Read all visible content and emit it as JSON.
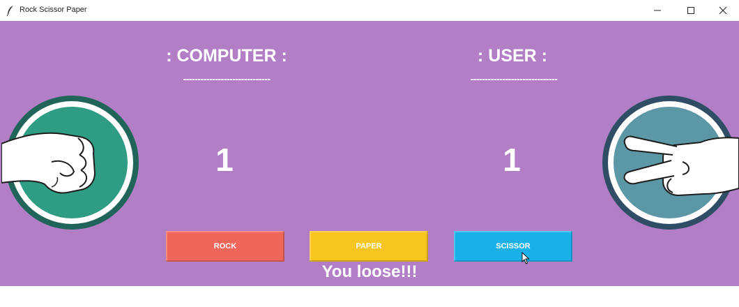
{
  "window": {
    "title": "Rock Scissor Paper",
    "controls": [
      "minimize",
      "maximize",
      "close"
    ]
  },
  "colors": {
    "background": "#b27fc6",
    "rock_button": "#f0665a",
    "paper_button": "#f6c51f",
    "scissor_button": "#1ab0e9",
    "text": "#ffffff"
  },
  "computer": {
    "heading": ": COMPUTER :",
    "divider": "------------------------------",
    "score": "1",
    "hand_icon": "rock-hand-icon"
  },
  "user": {
    "heading": ": USER :",
    "divider": "------------------------------",
    "score": "1",
    "hand_icon": "scissor-hand-icon"
  },
  "buttons": {
    "rock": "ROCK",
    "paper": "PAPER",
    "scissor": "SCISSOR"
  },
  "result": "You loose!!!"
}
